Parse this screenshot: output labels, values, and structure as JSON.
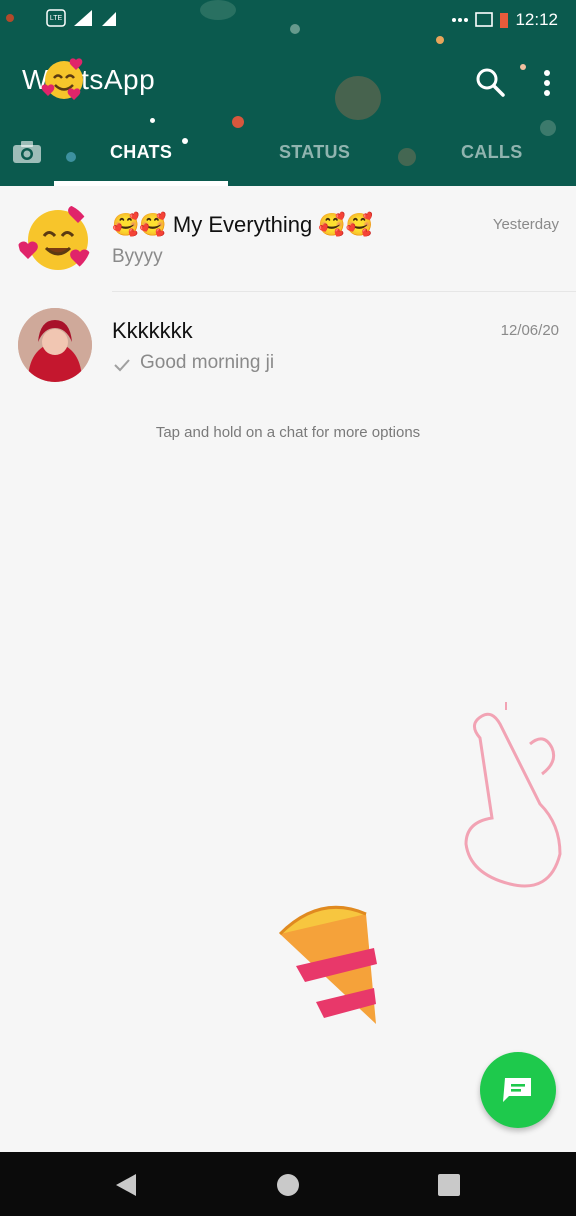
{
  "status_bar": {
    "left_icons": [
      "volte-icon",
      "4g-signal-icon",
      "signal-icon"
    ],
    "right_icons": [
      "more-dots-icon",
      "cast-icon",
      "battery-icon"
    ],
    "time": "12:12"
  },
  "app_bar": {
    "title": "WhatsApp",
    "search_icon": "search-icon",
    "menu_icon": "more-vert-icon",
    "camera_icon": "camera-icon"
  },
  "tabs": [
    {
      "label": "CHATS",
      "selected": true
    },
    {
      "label": "STATUS",
      "selected": false
    },
    {
      "label": "CALLS",
      "selected": false
    }
  ],
  "chats": [
    {
      "name": "🥰🥰 My Everything 🥰🥰",
      "date": "Yesterday",
      "preview": "Byyyy",
      "read_tick": false
    },
    {
      "name": "Kkkkkkk",
      "date": "12/06/20",
      "preview": "Good morning ji",
      "read_tick": true
    }
  ],
  "hint": "Tap and hold on a chat for more options",
  "fab": {
    "icon": "new-chat-icon"
  },
  "nav": {
    "back_icon": "back-icon",
    "home_icon": "home-icon",
    "recent_icon": "recent-apps-icon"
  },
  "colors": {
    "header": "#0b5a4e",
    "accent": "#1ec94c",
    "background": "#f6f6f6"
  }
}
